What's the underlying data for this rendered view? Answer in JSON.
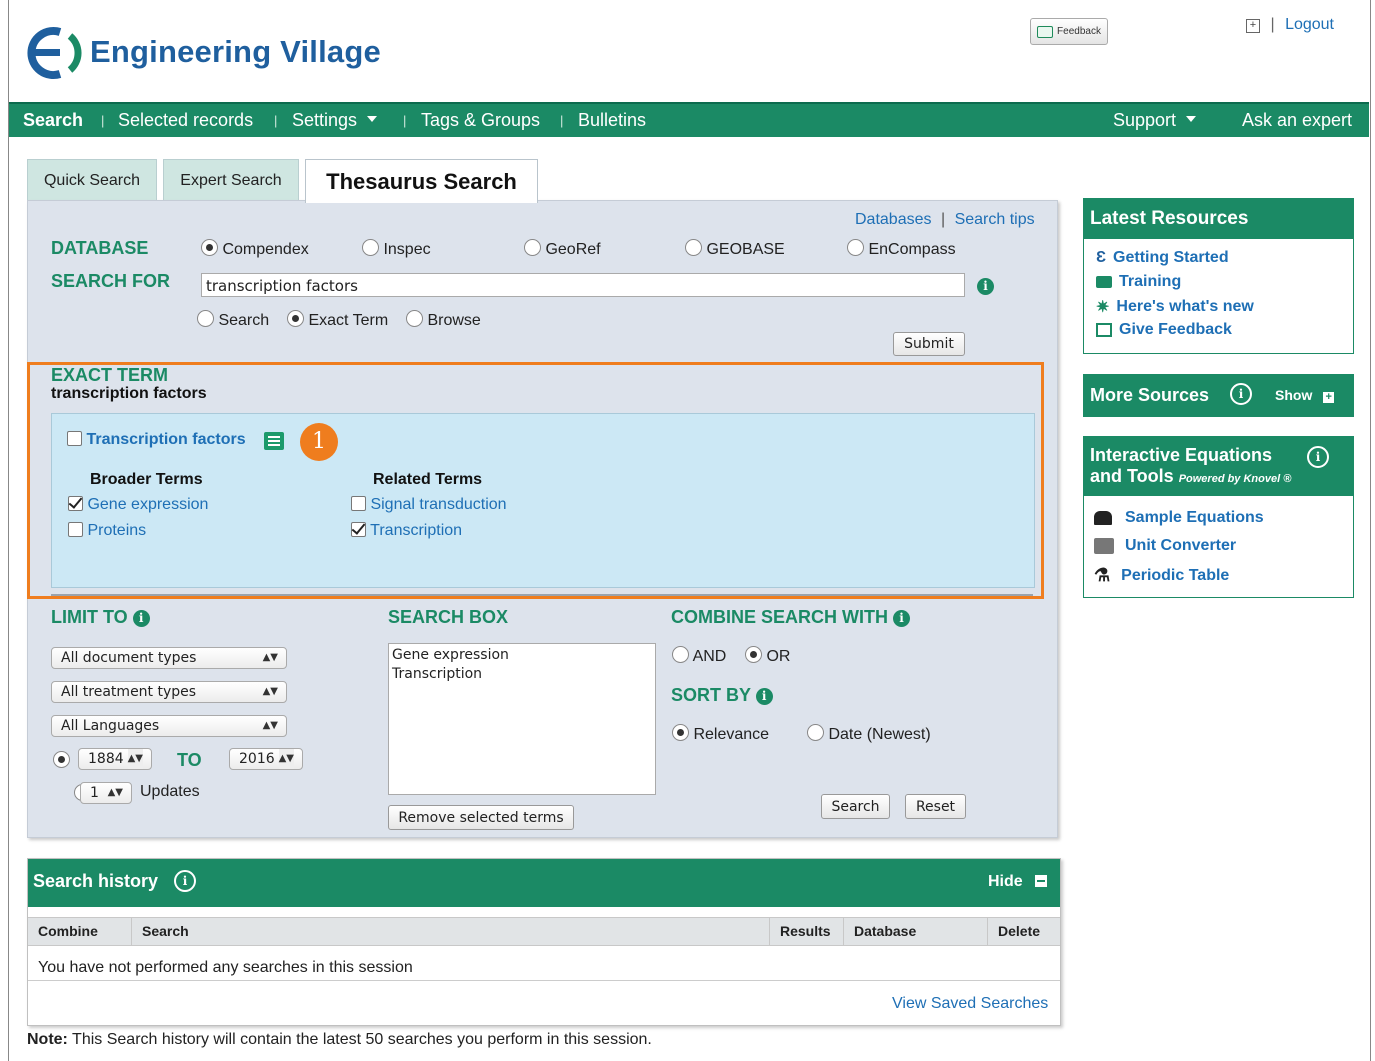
{
  "brand": {
    "name": "Engineering Village"
  },
  "top": {
    "feedback_label": "Feedback",
    "logout_label": "Logout"
  },
  "nav": {
    "items": [
      "Search",
      "Selected records",
      "Settings",
      "Tags & Groups",
      "Bulletins"
    ],
    "right": [
      "Support",
      "Ask an expert"
    ]
  },
  "tabs": [
    "Quick Search",
    "Expert Search",
    "Thesaurus Search"
  ],
  "links": {
    "databases": "Databases",
    "search_tips": "Search tips"
  },
  "labels": {
    "database": "DATABASE",
    "search_for": "SEARCH FOR"
  },
  "databases": [
    {
      "label": "Compendex",
      "selected": true
    },
    {
      "label": "Inspec",
      "selected": false
    },
    {
      "label": "GeoRef",
      "selected": false
    },
    {
      "label": "GEOBASE",
      "selected": false
    },
    {
      "label": "EnCompass",
      "selected": false
    }
  ],
  "search": {
    "value": "transcription factors",
    "modes": [
      {
        "label": "Search",
        "selected": false
      },
      {
        "label": "Exact Term",
        "selected": true
      },
      {
        "label": "Browse",
        "selected": false
      }
    ],
    "submit_label": "Submit"
  },
  "exact_term": {
    "heading": "EXACT TERM",
    "term": "transcription factors",
    "main_term": "Transcription factors",
    "badge": "1",
    "broader_heading": "Broader Terms",
    "related_heading": "Related Terms",
    "broader": [
      {
        "label": "Gene expression",
        "checked": true
      },
      {
        "label": "Proteins",
        "checked": false
      }
    ],
    "related": [
      {
        "label": "Signal transduction",
        "checked": false
      },
      {
        "label": "Transcription",
        "checked": true
      }
    ]
  },
  "limit": {
    "heading": "LIMIT TO",
    "doc_types": "All document types",
    "treatment_types": "All treatment types",
    "languages": "All Languages",
    "from_year": "1884",
    "to_label": "TO",
    "to_year": "2016",
    "updates_value": "1",
    "updates_label": "Updates"
  },
  "search_box": {
    "heading": "SEARCH BOX",
    "terms": [
      "Gene expression",
      "Transcription"
    ],
    "remove_label": "Remove selected terms"
  },
  "combine": {
    "heading": "COMBINE SEARCH WITH",
    "options": [
      {
        "label": "AND",
        "selected": false
      },
      {
        "label": "OR",
        "selected": true
      }
    ]
  },
  "sort": {
    "heading": "SORT BY",
    "options": [
      {
        "label": "Relevance",
        "selected": true
      },
      {
        "label": "Date (Newest)",
        "selected": false
      }
    ]
  },
  "actions": {
    "search": "Search",
    "reset": "Reset"
  },
  "sidebar": {
    "latest_title": "Latest Resources",
    "latest_items": [
      "Getting Started",
      "Training",
      "Here's what's new",
      "Give Feedback"
    ],
    "more_sources_title": "More Sources",
    "more_sources_show": "Show",
    "equations_title_1": "Interactive Equations",
    "equations_title_2": "and Tools",
    "equations_powered": "Powered by Knovel ®",
    "equations_items": [
      "Sample Equations",
      "Unit Converter",
      "Periodic Table"
    ]
  },
  "history": {
    "title": "Search history",
    "hide_label": "Hide",
    "columns": [
      "Combine",
      "Search",
      "Results",
      "Database",
      "Delete"
    ],
    "empty_message": "You have not performed any searches in this session",
    "view_saved": "View Saved Searches",
    "note_label": "Note:",
    "note_text": " This Search history will contain the latest 50 searches you perform in this session."
  },
  "colors": {
    "brand_green": "#1b8a65",
    "link_blue": "#1e6fb5",
    "highlight_orange": "#ef7d1e",
    "panel_bg": "#dde3ec",
    "term_bg": "#cce8f5"
  }
}
